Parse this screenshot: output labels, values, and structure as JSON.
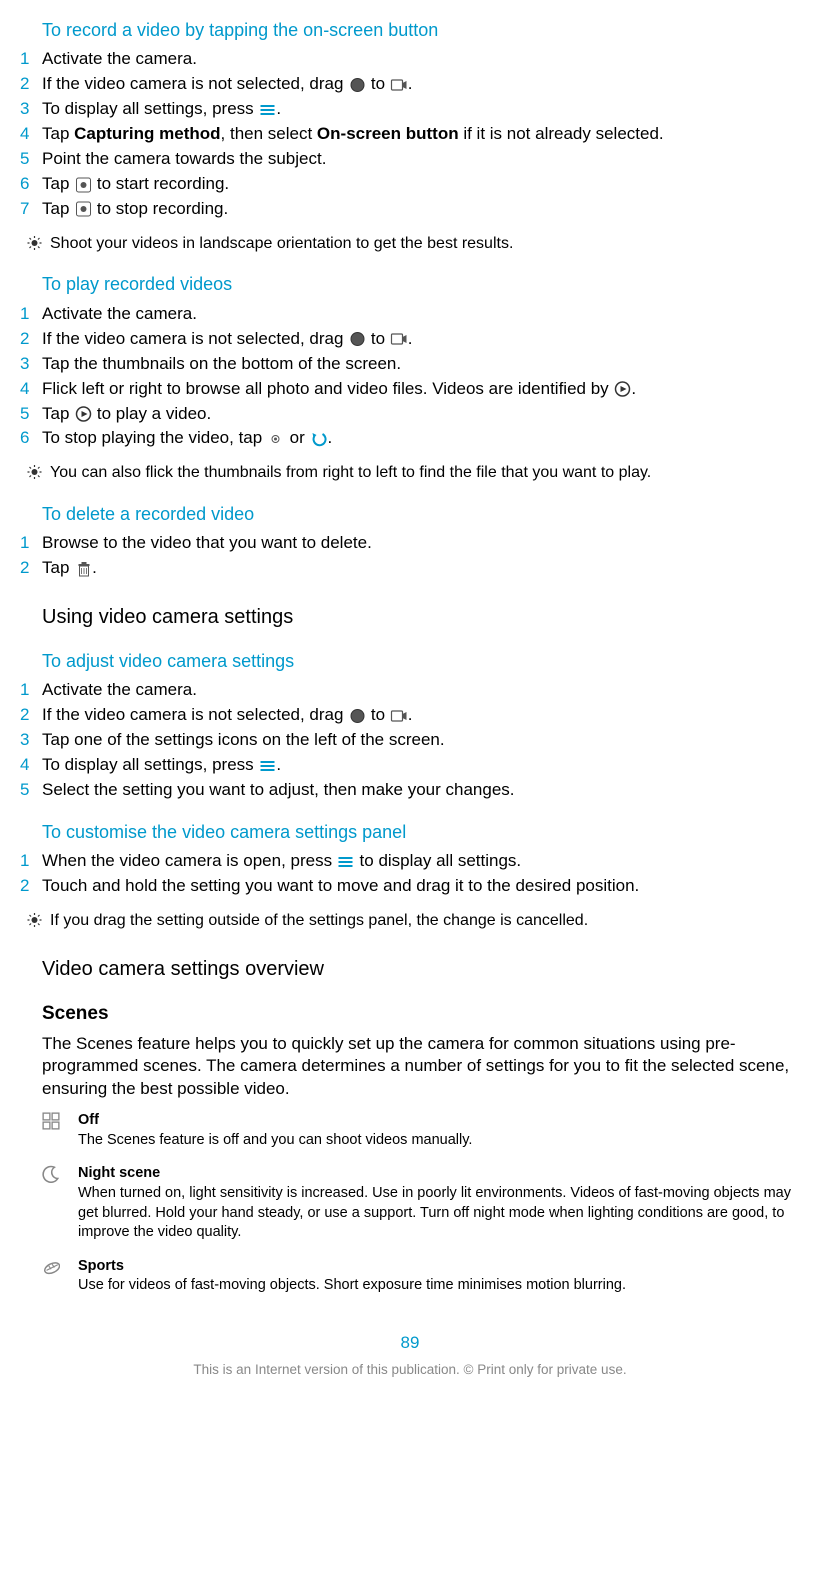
{
  "sections": [
    {
      "heading": "To record a video by tapping the on-screen button",
      "steps": [
        {
          "n": "1",
          "pre": "Activate the camera.",
          "icons": [],
          "post": ""
        },
        {
          "n": "2",
          "pre": "If the video camera is not selected, drag ",
          "icons": [
            "circle-icon"
          ],
          "mid": " to ",
          "icons2": [
            "videocam-icon"
          ],
          "post": "."
        },
        {
          "n": "3",
          "pre": "To display all settings, press ",
          "icons": [
            "menu-icon"
          ],
          "post": "."
        },
        {
          "n": "4",
          "pre": "Tap ",
          "bold1": "Capturing method",
          "mid2": ", then select ",
          "bold2": "On-screen button",
          "post": " if it is not already selected."
        },
        {
          "n": "5",
          "pre": "Point the camera towards the subject.",
          "icons": [],
          "post": ""
        },
        {
          "n": "6",
          "pre": "Tap ",
          "icons": [
            "record-icon"
          ],
          "post": " to start recording."
        },
        {
          "n": "7",
          "pre": "Tap ",
          "icons": [
            "record-icon"
          ],
          "post": " to stop recording."
        }
      ],
      "tip": "Shoot your videos in landscape orientation to get the best results."
    },
    {
      "heading": "To play recorded videos",
      "steps": [
        {
          "n": "1",
          "pre": "Activate the camera.",
          "icons": [],
          "post": ""
        },
        {
          "n": "2",
          "pre": "If the video camera is not selected, drag ",
          "icons": [
            "circle-icon"
          ],
          "mid": " to ",
          "icons2": [
            "videocam-icon"
          ],
          "post": "."
        },
        {
          "n": "3",
          "pre": "Tap the thumbnails on the bottom of the screen.",
          "icons": [],
          "post": ""
        },
        {
          "n": "4",
          "pre": "Flick left or right to browse all photo and video files. Videos are identified by ",
          "icons": [
            "play-box-icon"
          ],
          "post": "."
        },
        {
          "n": "5",
          "pre": "Tap ",
          "icons": [
            "play-box-icon"
          ],
          "post": " to play a video."
        },
        {
          "n": "6",
          "pre": "To stop playing the video, tap ",
          "icons": [
            "dot-icon"
          ],
          "mid": " or ",
          "icons2": [
            "back-arrow-icon"
          ],
          "post": "."
        }
      ],
      "tip": "You can also flick the thumbnails from right to left to find the file that you want to play."
    },
    {
      "heading": "To delete a recorded video",
      "steps": [
        {
          "n": "1",
          "pre": "Browse to the video that you want to delete.",
          "icons": [],
          "post": ""
        },
        {
          "n": "2",
          "pre": "Tap ",
          "icons": [
            "trash-icon"
          ],
          "post": "."
        }
      ]
    }
  ],
  "h2a": "Using video camera settings",
  "adjust": {
    "heading": "To adjust video camera settings",
    "steps": [
      {
        "n": "1",
        "pre": "Activate the camera.",
        "icons": [],
        "post": ""
      },
      {
        "n": "2",
        "pre": "If the video camera is not selected, drag ",
        "icons": [
          "circle-icon"
        ],
        "mid": " to ",
        "icons2": [
          "videocam-icon"
        ],
        "post": "."
      },
      {
        "n": "3",
        "pre": "Tap one of the settings icons on the left of the screen.",
        "icons": [],
        "post": ""
      },
      {
        "n": "4",
        "pre": "To display all settings, press ",
        "icons": [
          "menu-icon"
        ],
        "post": "."
      },
      {
        "n": "5",
        "pre": "Select the setting you want to adjust, then make your changes.",
        "icons": [],
        "post": ""
      }
    ]
  },
  "customise": {
    "heading": "To customise the video camera settings panel",
    "steps": [
      {
        "n": "1",
        "pre": "When the video camera is open, press ",
        "icons": [
          "menu-icon"
        ],
        "post": " to display all settings."
      },
      {
        "n": "2",
        "pre": "Touch and hold the setting you want to move and drag it to the desired position.",
        "icons": [],
        "post": ""
      }
    ],
    "tip": "If you drag the setting outside of the settings panel, the change is cancelled."
  },
  "h2b": "Video camera settings overview",
  "scenes": {
    "title": "Scenes",
    "para": "The Scenes feature helps you to quickly set up the camera for common situations using pre-programmed scenes. The camera determines a number of settings for you to fit the selected scene, ensuring the best possible video.",
    "items": [
      {
        "icon": "grid-icon",
        "title": "Off",
        "desc": "The Scenes feature is off and you can shoot videos manually."
      },
      {
        "icon": "moon-icon",
        "title": "Night scene",
        "desc": "When turned on, light sensitivity is increased. Use in poorly lit environments. Videos of fast-moving objects may get blurred. Hold your hand steady, or use a support. Turn off night mode when lighting conditions are good, to improve the video quality."
      },
      {
        "icon": "sports-icon",
        "title": "Sports",
        "desc": "Use for videos of fast-moving objects. Short exposure time minimises motion blurring."
      }
    ]
  },
  "pageNum": "89",
  "footer": "This is an Internet version of this publication. © Print only for private use."
}
